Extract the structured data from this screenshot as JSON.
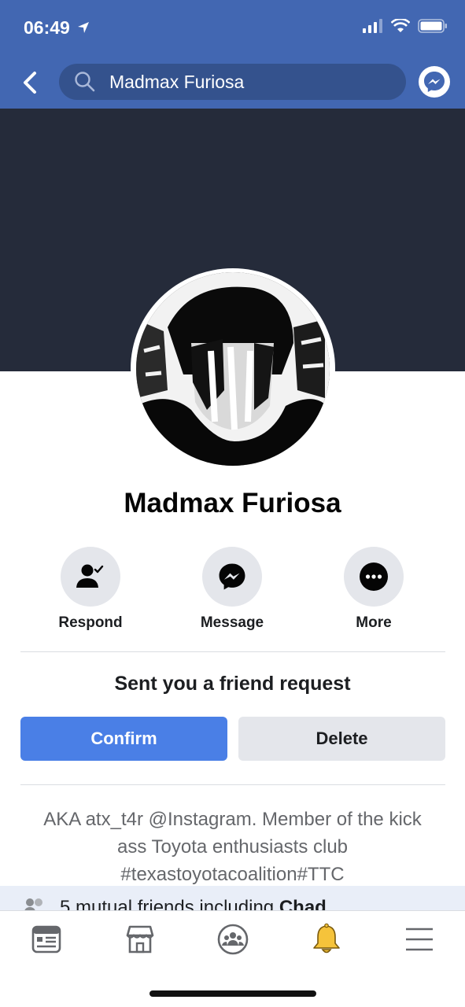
{
  "status": {
    "time": "06:49"
  },
  "search": {
    "value": "Madmax Furiosa"
  },
  "profile": {
    "name": "Madmax Furiosa"
  },
  "actions": [
    {
      "label": "Respond",
      "icon": "person-check-icon"
    },
    {
      "label": "Message",
      "icon": "messenger-icon"
    },
    {
      "label": "More",
      "icon": "more-dots-icon"
    }
  ],
  "friend_request": {
    "text": "Sent you a friend request",
    "confirm_label": "Confirm",
    "delete_label": "Delete"
  },
  "bio": {
    "line1": "AKA atx_t4r @Instagram. Member of the kick",
    "line2": "ass Toyota enthusiasts club",
    "line3": "#texastoyotacoalition#TTC"
  },
  "mutual": {
    "text": "5 mutual friends including ",
    "bold": "Chad"
  },
  "tabs": [
    "news-feed-icon",
    "marketplace-icon",
    "groups-icon",
    "notifications-bell-icon",
    "menu-icon"
  ],
  "colors": {
    "brand": "#4267b2",
    "confirm": "#4a7fe6",
    "bell": "#f5c33b"
  }
}
